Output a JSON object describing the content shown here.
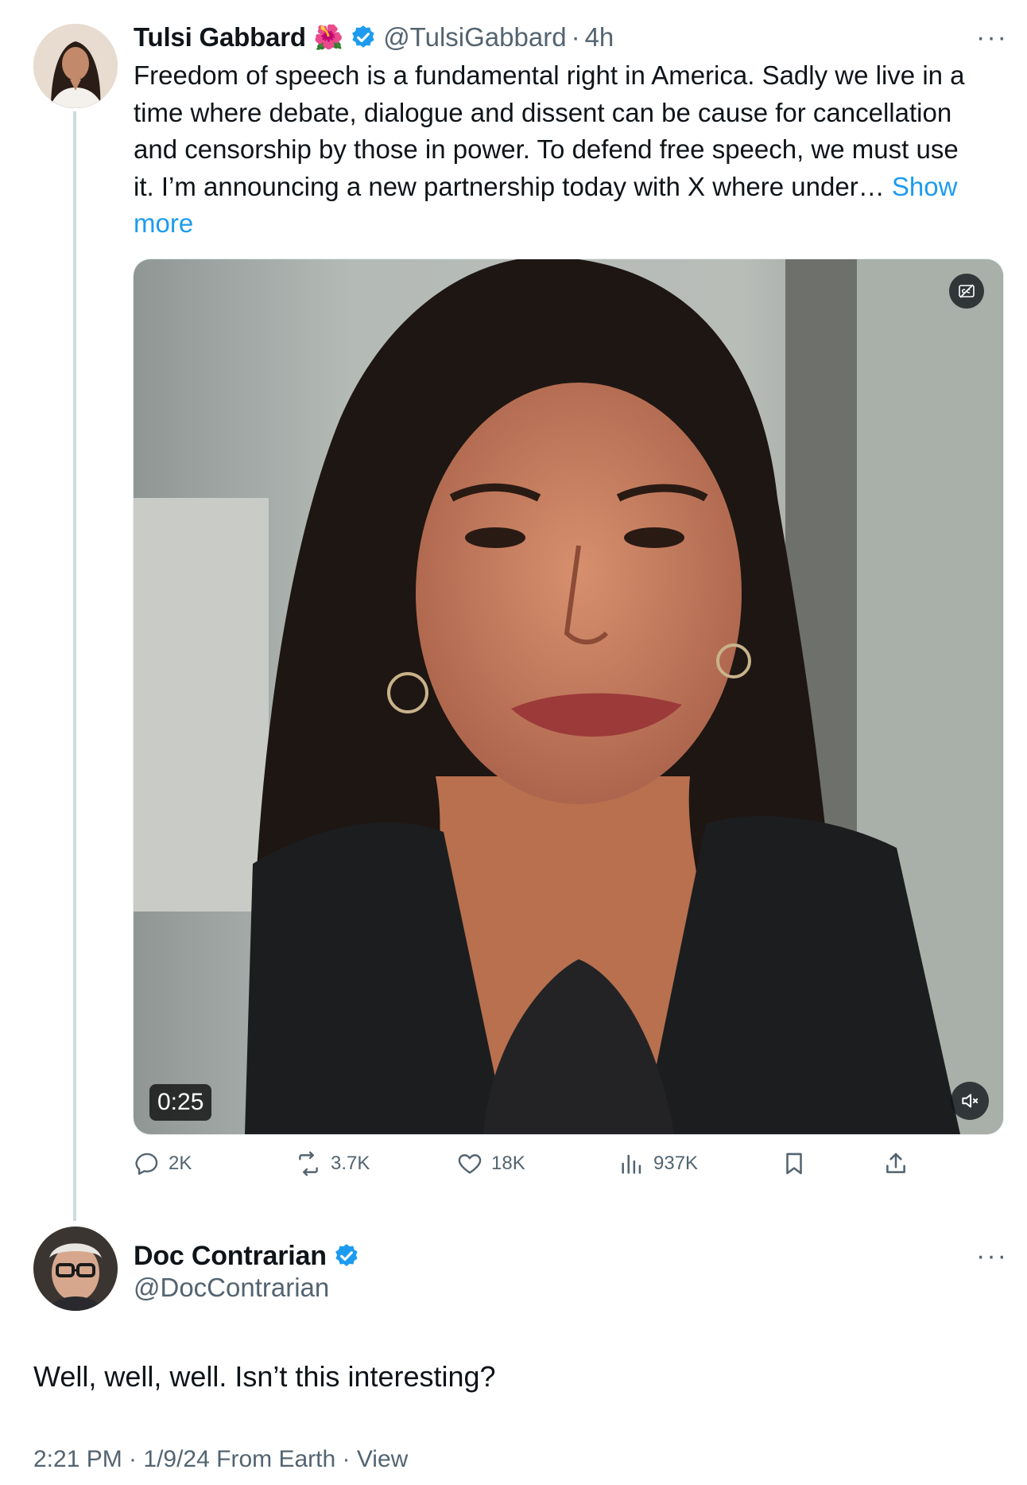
{
  "tweet": {
    "author_name": "Tulsi Gabbard",
    "flag_emoji": "🌺",
    "handle": "@TulsiGabbard",
    "separator": "·",
    "time": "4h",
    "more": "···",
    "text_lines": [
      "Freedom of speech is a fundamental right in America. Sadly we live in a",
      "time where debate, dialogue and dissent can be cause for cancellation",
      "and censorship by those in power. To defend free speech, we must use",
      "it. I’m announcing a new partnership today with X where under… "
    ],
    "show_more_1": "Show",
    "show_more_2": "more",
    "video": {
      "duration": "0:25"
    },
    "actions": {
      "replies": "2K",
      "reposts": "3.7K",
      "likes": "18K",
      "views": "937K"
    }
  },
  "reply": {
    "author_name": "Doc Contrarian",
    "handle": "@DocContrarian",
    "more": "···",
    "text": "Well, well, well. Isn’t this interesting?",
    "meta": "2:21 PM · 1/9/24 From Earth · View"
  },
  "colors": {
    "link": "#1d9bf0",
    "muted": "#536471",
    "verified": "#1d9bf0"
  }
}
